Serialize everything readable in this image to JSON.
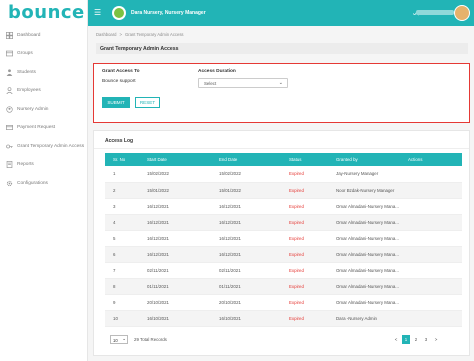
{
  "brand": {
    "logo_text": "bounce",
    "accent": "#22b4b6",
    "danger": "#e53935"
  },
  "sidebar": {
    "items": [
      {
        "label": "Dashboard",
        "icon": "dashboard-icon"
      },
      {
        "label": "Groups",
        "icon": "groups-icon"
      },
      {
        "label": "Students",
        "icon": "students-icon"
      },
      {
        "label": "Employees",
        "icon": "employees-icon"
      },
      {
        "label": "Nursery Admin",
        "icon": "nursery-admin-icon"
      },
      {
        "label": "Payment Request",
        "icon": "payment-icon"
      },
      {
        "label": "Grant Temporary Admin Access",
        "icon": "key-icon"
      },
      {
        "label": "Reports",
        "icon": "reports-icon"
      },
      {
        "label": "Configurations",
        "icon": "gear-icon"
      }
    ]
  },
  "topbar": {
    "org_title": "Dara Nursery, Nursery Manager",
    "language": "عربي"
  },
  "breadcrumb": {
    "home": "Dashboard",
    "current": "Grant Temporary Admin Access"
  },
  "page": {
    "title": "Grant Temporary Admin Access"
  },
  "grant_form": {
    "grant_access_label": "Grant Access To",
    "grant_access_value": "Bounce support",
    "duration_label": "Access Duration",
    "duration_selected": "Select",
    "submit_label": "SUBMIT",
    "reset_label": "RESET"
  },
  "access_log": {
    "title": "Access Log",
    "columns": [
      "Sr. No",
      "Start Date",
      "End Date",
      "Status",
      "Granted by",
      "Actions"
    ],
    "rows": [
      {
        "no": "1",
        "start": "15/02/2022",
        "end": "15/02/2022",
        "status": "Expired",
        "granted_by": "Jay-Nursery Manager"
      },
      {
        "no": "2",
        "start": "15/01/2022",
        "end": "15/01/2022",
        "status": "Expired",
        "granted_by": "Noor Bzdak-Nursery Manager"
      },
      {
        "no": "3",
        "start": "16/12/2021",
        "end": "16/12/2021",
        "status": "Expired",
        "granted_by": "Omar Almadani-Nursery Mana..."
      },
      {
        "no": "4",
        "start": "16/12/2021",
        "end": "16/12/2021",
        "status": "Expired",
        "granted_by": "Omar Almadani-Nursery Mana..."
      },
      {
        "no": "5",
        "start": "16/12/2021",
        "end": "16/12/2021",
        "status": "Expired",
        "granted_by": "Omar Almadani-Nursery Mana..."
      },
      {
        "no": "6",
        "start": "16/12/2021",
        "end": "16/12/2021",
        "status": "Expired",
        "granted_by": "Omar Almadani-Nursery Mana..."
      },
      {
        "no": "7",
        "start": "02/11/2021",
        "end": "02/11/2021",
        "status": "Expired",
        "granted_by": "Omar Almadani-Nursery Mana..."
      },
      {
        "no": "8",
        "start": "01/11/2021",
        "end": "01/11/2021",
        "status": "Expired",
        "granted_by": "Omar Almadani-Nursery Mana..."
      },
      {
        "no": "9",
        "start": "20/10/2021",
        "end": "20/10/2021",
        "status": "Expired",
        "granted_by": "Omar Almadani-Nursery Mana..."
      },
      {
        "no": "10",
        "start": "16/10/2021",
        "end": "16/10/2021",
        "status": "Expired",
        "granted_by": "Dara -Nursery Admin"
      }
    ],
    "per_page": "10",
    "total_records": "29 Total Records",
    "pagination": [
      "<",
      "1",
      "2",
      "3",
      ">"
    ],
    "current_page": "1"
  }
}
